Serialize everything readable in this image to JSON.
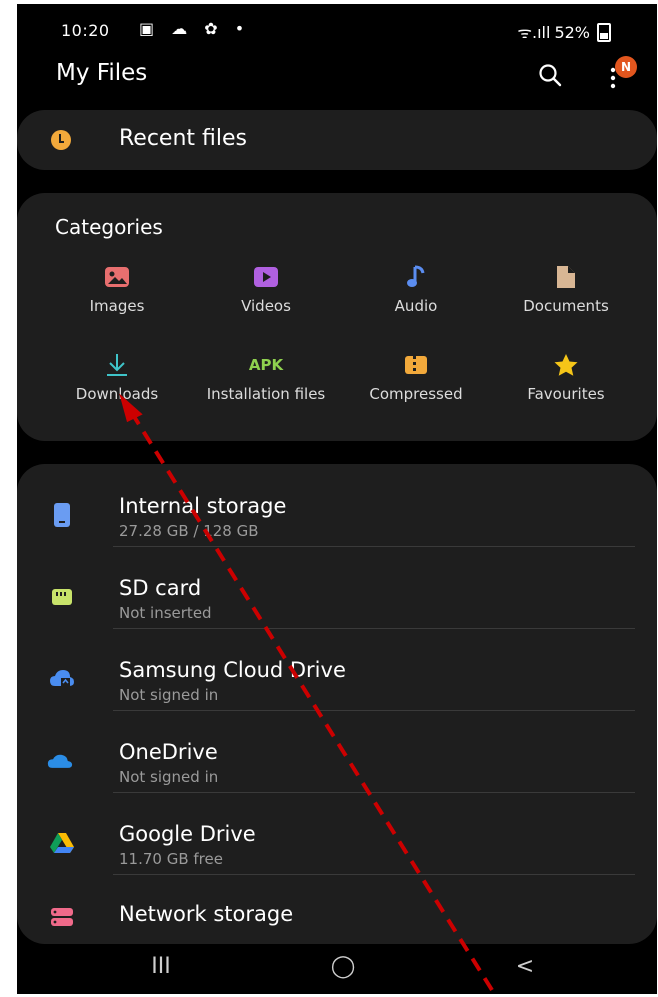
{
  "status": {
    "time": "10:20",
    "left_icons": "▣ ☁ ✿ •",
    "signal": "ᯤ.ıll",
    "battery": "52%"
  },
  "appbar": {
    "title": "My Files",
    "search_icon": "search-icon",
    "more_icon": "more-vertical-icon",
    "badge": "N"
  },
  "recent": {
    "label": "Recent files",
    "icon": "clock-icon"
  },
  "categories": {
    "title": "Categories",
    "items": [
      {
        "label": "Images",
        "icon": "image-icon",
        "color": "#e86f6f"
      },
      {
        "label": "Videos",
        "icon": "video-icon",
        "color": "#b060e0"
      },
      {
        "label": "Audio",
        "icon": "music-note-icon",
        "color": "#5b8df0"
      },
      {
        "label": "Documents",
        "icon": "document-icon",
        "color": "#d8b694"
      },
      {
        "label": "Downloads",
        "icon": "download-icon",
        "color": "#3fc4c9"
      },
      {
        "label": "Installation files",
        "icon": "apk-icon",
        "color": "#8fd14f"
      },
      {
        "label": "Compressed",
        "icon": "archive-icon",
        "color": "#f2a93b"
      },
      {
        "label": "Favourites",
        "icon": "star-icon",
        "color": "#f5c518"
      }
    ]
  },
  "storage": [
    {
      "title": "Internal storage",
      "subtitle": "27.28 GB / 128 GB",
      "icon": "phone-storage-icon",
      "color": "#6a9cf2"
    },
    {
      "title": "SD card",
      "subtitle": "Not inserted",
      "icon": "sd-card-icon",
      "color": "#c8e36a"
    },
    {
      "title": "Samsung Cloud Drive",
      "subtitle": "Not signed in",
      "icon": "samsung-cloud-icon",
      "color": "#4a8df0"
    },
    {
      "title": "OneDrive",
      "subtitle": "Not signed in",
      "icon": "onedrive-icon",
      "color": "#2b8de6"
    },
    {
      "title": "Google Drive",
      "subtitle": "11.70 GB free",
      "icon": "google-drive-icon",
      "color": "#fbbc04"
    },
    {
      "title": "Network storage",
      "subtitle": "",
      "icon": "network-storage-icon",
      "color": "#f06a8a"
    }
  ],
  "navbar": {
    "recents": "III",
    "home": "◯",
    "back": "<"
  },
  "annotation": {
    "color": "#cc0000",
    "target": "Downloads"
  }
}
